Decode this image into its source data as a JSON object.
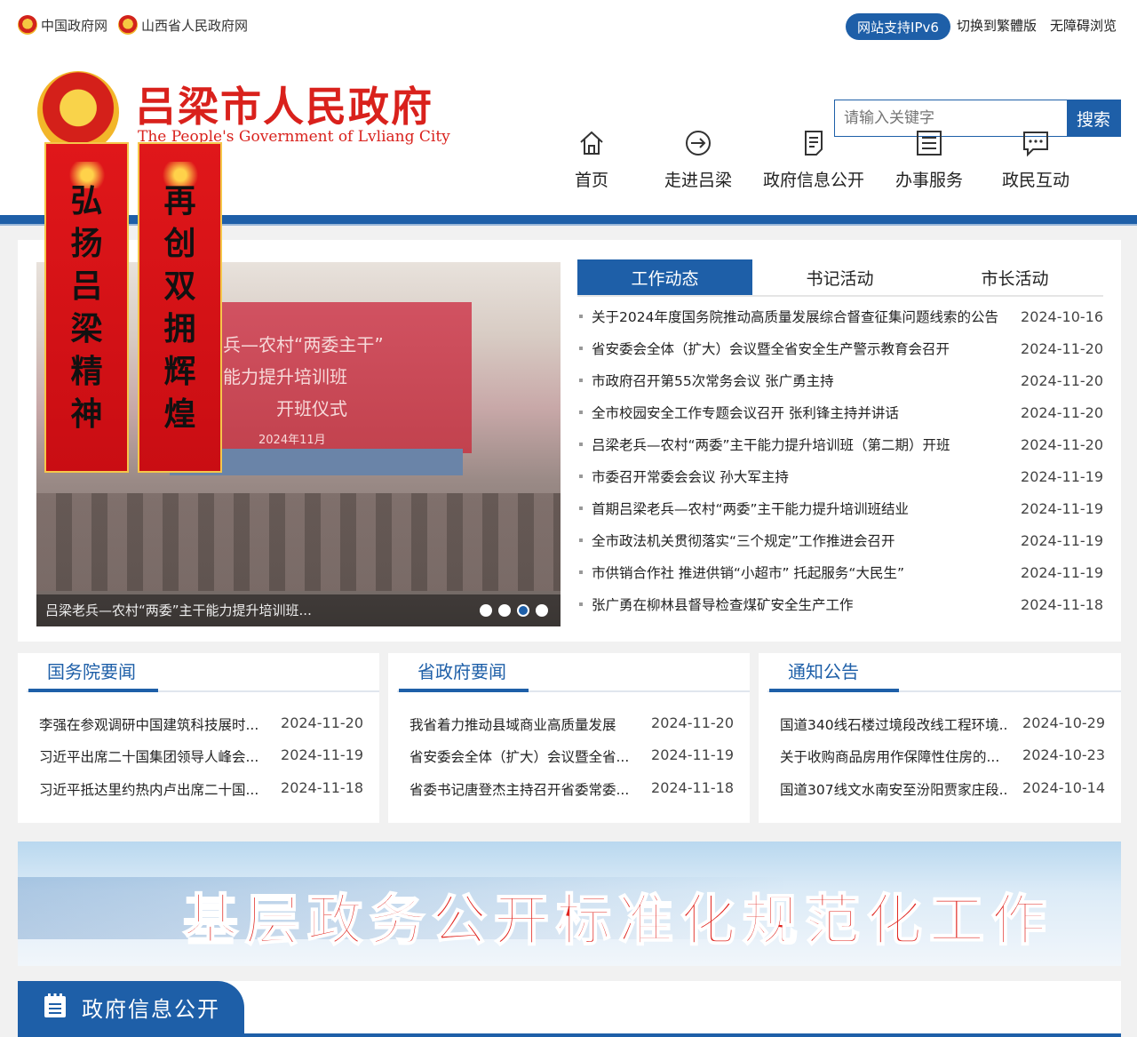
{
  "topbar": {
    "links": [
      "中国政府网",
      "山西省人民政府网"
    ],
    "ipv6": "网站支持IPv6",
    "traditional": "切换到繁體版",
    "accessible": "无障碍浏览"
  },
  "header": {
    "title": "吕梁市人民政府",
    "subtitle": "The People's Government of Lvliang City",
    "search_placeholder": "请输入关键字",
    "search_button": "搜索"
  },
  "nav": [
    {
      "label": "首页",
      "icon": "home-icon"
    },
    {
      "label": "走进吕梁",
      "icon": "arrow-circle-icon"
    },
    {
      "label": "政府信息公开",
      "icon": "document-icon"
    },
    {
      "label": "办事服务",
      "icon": "list-icon"
    },
    {
      "label": "政民互动",
      "icon": "chat-icon"
    }
  ],
  "banners": {
    "left": "弘扬吕梁精神",
    "right": "再创双拥辉煌"
  },
  "slider": {
    "screen_text": [
      "兵—农村“两委主干”",
      "能力提升培训班",
      "开班仪式",
      "2024年11月"
    ],
    "caption": "吕梁老兵—农村“两委”主干能力提升培训班...",
    "dots": 4,
    "active_dot": 3
  },
  "tabs": [
    "工作动态",
    "书记活动",
    "市长活动"
  ],
  "news": [
    {
      "title": "关于2024年度国务院推动高质量发展综合督查征集问题线索的公告",
      "date": "2024-10-16"
    },
    {
      "title": "省安委会全体（扩大）会议暨全省安全生产警示教育会召开",
      "date": "2024-11-20"
    },
    {
      "title": "市政府召开第55次常务会议 张广勇主持",
      "date": "2024-11-20"
    },
    {
      "title": "全市校园安全工作专题会议召开 张利锋主持并讲话",
      "date": "2024-11-20"
    },
    {
      "title": "吕梁老兵—农村“两委”主干能力提升培训班（第二期）开班",
      "date": "2024-11-20"
    },
    {
      "title": "市委召开常委会会议 孙大军主持",
      "date": "2024-11-19"
    },
    {
      "title": "首期吕梁老兵—农村“两委”主干能力提升培训班结业",
      "date": "2024-11-19"
    },
    {
      "title": "全市政法机关贯彻落实“三个规定”工作推进会召开",
      "date": "2024-11-19"
    },
    {
      "title": "市供销合作社 推进供销“小超市” 托起服务“大民生”",
      "date": "2024-11-19"
    },
    {
      "title": "张广勇在柳林县督导检查煤矿安全生产工作",
      "date": "2024-11-18"
    }
  ],
  "boxes": [
    {
      "title": "国务院要闻",
      "items": [
        {
          "title": "李强在参观调研中国建筑科技展时...",
          "date": "2024-11-20"
        },
        {
          "title": "习近平出席二十国集团领导人峰会...",
          "date": "2024-11-19"
        },
        {
          "title": "习近平抵达里约热内卢出席二十国...",
          "date": "2024-11-18"
        }
      ]
    },
    {
      "title": "省政府要闻",
      "items": [
        {
          "title": "我省着力推动县域商业高质量发展",
          "date": "2024-11-20"
        },
        {
          "title": "省安委会全体（扩大）会议暨全省...",
          "date": "2024-11-19"
        },
        {
          "title": "省委书记唐登杰主持召开省委常委...",
          "date": "2024-11-18"
        }
      ]
    },
    {
      "title": "通知公告",
      "items": [
        {
          "title": "国道340线石楼过境段改线工程环境...",
          "date": "2024-10-29"
        },
        {
          "title": "关于收购商品房用作保障性住房的...",
          "date": "2024-10-23"
        },
        {
          "title": "国道307线文水南安至汾阳贾家庄段...",
          "date": "2024-10-14"
        }
      ]
    }
  ],
  "ad_banner": "基层政务公开标准化规范化工作",
  "section": {
    "title": "政府信息公开",
    "icon": "calendar-list-icon"
  },
  "colors": {
    "brand_blue": "#1e5fa8",
    "brand_red": "#d9211c"
  }
}
